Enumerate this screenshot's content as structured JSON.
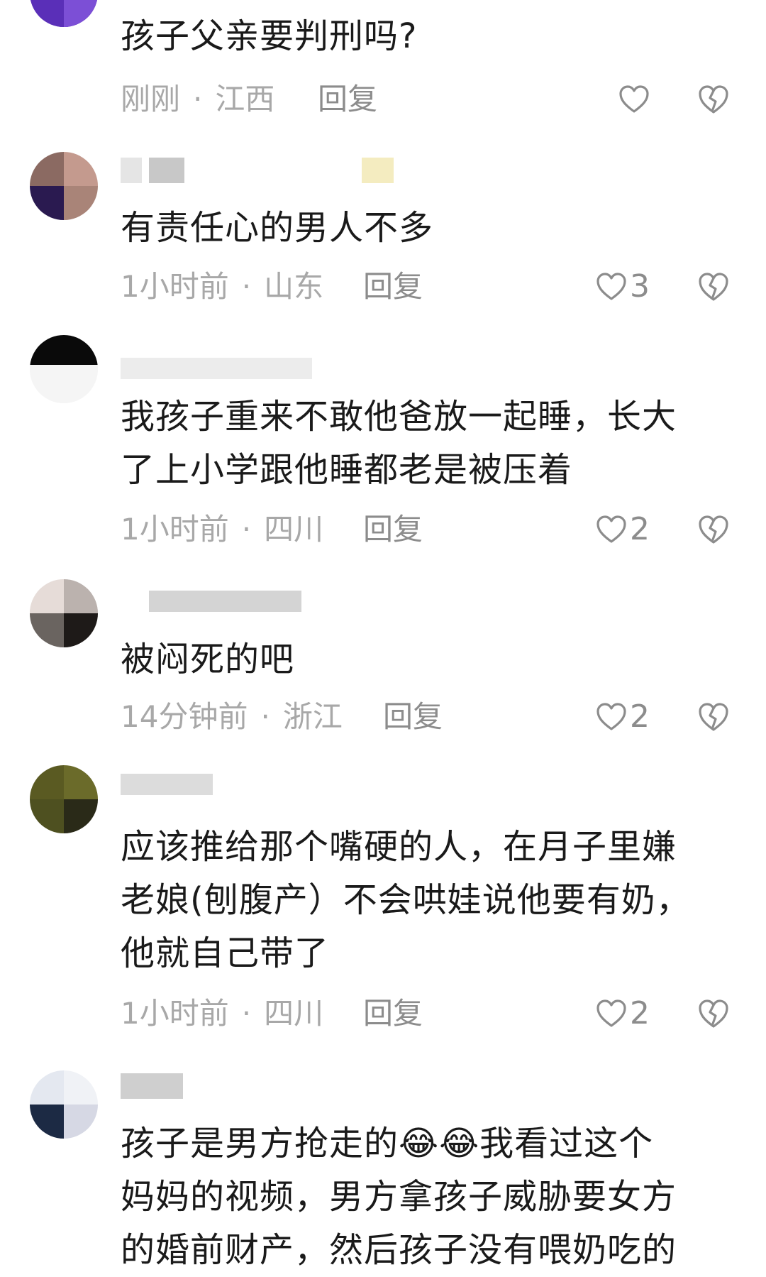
{
  "comments": [
    {
      "text": "孩子父亲要判刑吗?",
      "time": "刚刚",
      "location": "江西",
      "reply_label": "回复",
      "likes": ""
    },
    {
      "text": "有责任心的男人不多",
      "time": "1小时前",
      "location": "山东",
      "reply_label": "回复",
      "likes": "3"
    },
    {
      "text": "我孩子重来不敢他爸放一起睡，长大\n了上小学跟他睡都老是被压着",
      "time": "1小时前",
      "location": "四川",
      "reply_label": "回复",
      "likes": "2"
    },
    {
      "text": "被闷死的吧",
      "time": "14分钟前",
      "location": "浙江",
      "reply_label": "回复",
      "likes": "2"
    },
    {
      "text": "应该推给那个嘴硬的人，在月子里嫌\n老娘(刨腹产）不会哄娃说他要有奶，\n他就自己带了",
      "time": "1小时前",
      "location": "四川",
      "reply_label": "回复",
      "likes": "2"
    },
    {
      "text": "孩子是男方抢走的😂😂我看过这个\n妈妈的视频，男方拿孩子威胁要女方\n的婚前财产，然后孩子没有喂奶吃的"
    }
  ],
  "separator_dot": "·",
  "icons": {
    "like": "heart-outline-icon",
    "dislike": "broken-heart-icon"
  },
  "colors": {
    "meta": "#a8a8a8",
    "reply": "#8c8c8c",
    "text": "#1a1a1a"
  }
}
